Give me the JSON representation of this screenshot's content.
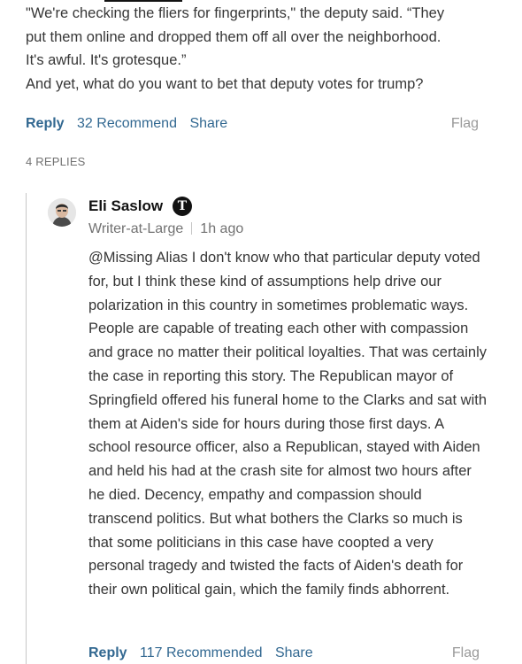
{
  "parent_comment": {
    "lines": [
      "\"We're checking the fliers for fingerprints,\" the deputy said. “They",
      "put them online and dropped them off all over the neighborhood.",
      "It's awful. It's grotesque.”",
      "And yet, what do you want to bet that deputy votes for trump?"
    ],
    "actions": {
      "reply": "Reply",
      "recommend": "32 Recommend",
      "share": "Share",
      "flag": "Flag"
    },
    "replies_count": "4 REPLIES"
  },
  "reply": {
    "author": "Eli Saslow",
    "badge": "T",
    "role": "Writer-at-Large",
    "time": "1h ago",
    "body": "@Missing Alias I don't know who that particular deputy voted for, but I think these kind of assumptions help drive our polarization in this country in sometimes problematic ways. People are capable of treating each other with compassion and grace no matter their political loyalties. That was certainly the case in reporting this story. The Republican mayor of Springfield offered his funeral home to the Clarks and sat with them at Aiden's side for hours during those first days. A  school resource officer, also a Republican, stayed with Aiden and held his had at the crash site for almost two hours after he died. Decency, empathy and compassion should transcend politics. But what bothers the Clarks so much is that some politicians in this case have coopted a very personal tragedy and twisted the facts of Aiden's death for their own political gain, which the family finds abhorrent.",
    "actions": {
      "reply": "Reply",
      "recommend": "117 Recommended",
      "share": "Share",
      "flag": "Flag"
    }
  },
  "colors": {
    "link": "#326891",
    "muted": "#727272",
    "flag": "#999999",
    "text": "#363636"
  }
}
